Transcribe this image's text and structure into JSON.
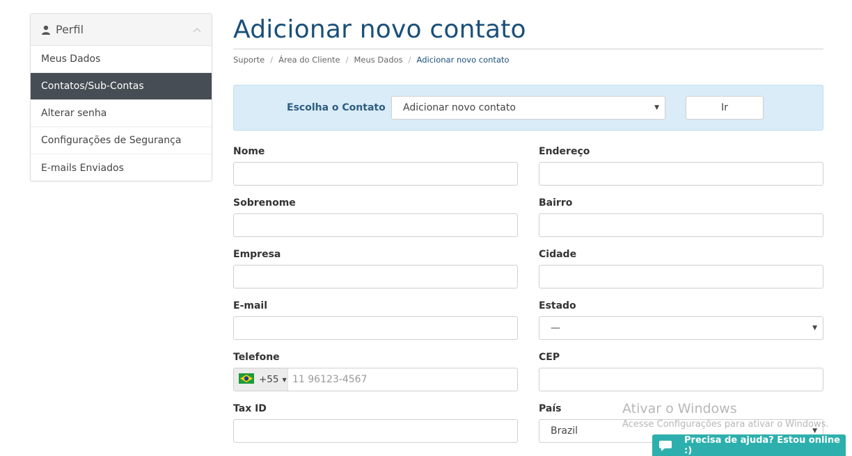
{
  "sidebar": {
    "header": {
      "title": "Perfil",
      "icon": "user-icon",
      "toggle_icon": "chevron-up-icon"
    },
    "items": [
      {
        "label": "Meus Dados",
        "active": false
      },
      {
        "label": "Contatos/Sub-Contas",
        "active": true
      },
      {
        "label": "Alterar senha",
        "active": false
      },
      {
        "label": "Configurações de Segurança",
        "active": false
      },
      {
        "label": "E-mails Enviados",
        "active": false
      }
    ]
  },
  "main": {
    "title": "Adicionar novo contato",
    "breadcrumb": [
      "Suporte",
      "Área do Cliente",
      "Meus Dados",
      "Adicionar novo contato"
    ]
  },
  "chooser": {
    "label": "Escolha o Contato",
    "selected": "Adicionar novo contato",
    "button": "Ir"
  },
  "form": {
    "nome": {
      "label": "Nome",
      "value": ""
    },
    "sobrenome": {
      "label": "Sobrenome",
      "value": ""
    },
    "empresa": {
      "label": "Empresa",
      "value": ""
    },
    "email": {
      "label": "E-mail",
      "value": ""
    },
    "telefone": {
      "label": "Telefone",
      "dial_code": "+55",
      "country_flag": "brazil-flag-icon",
      "placeholder": "11 96123-4567"
    },
    "tax_id": {
      "label": "Tax ID",
      "value": ""
    },
    "endereco": {
      "label": "Endereço",
      "value": ""
    },
    "bairro": {
      "label": "Bairro",
      "value": ""
    },
    "cidade": {
      "label": "Cidade",
      "value": ""
    },
    "estado": {
      "label": "Estado",
      "selected": "—"
    },
    "cep": {
      "label": "CEP",
      "value": ""
    },
    "pais": {
      "label": "País",
      "selected": "Brazil"
    }
  },
  "watermark": {
    "title": "Ativar o Windows",
    "subtitle": "Acesse Configurações para ativar o Windows."
  },
  "chat": {
    "label": "Precisa de ajuda? Estou online :)",
    "icon": "chat-bubble-icon"
  },
  "colors": {
    "title": "#1a4f7a",
    "active_item": "#474d54",
    "chooser_bg": "#d9ecf7",
    "chat_bg": "#2db0ad"
  }
}
